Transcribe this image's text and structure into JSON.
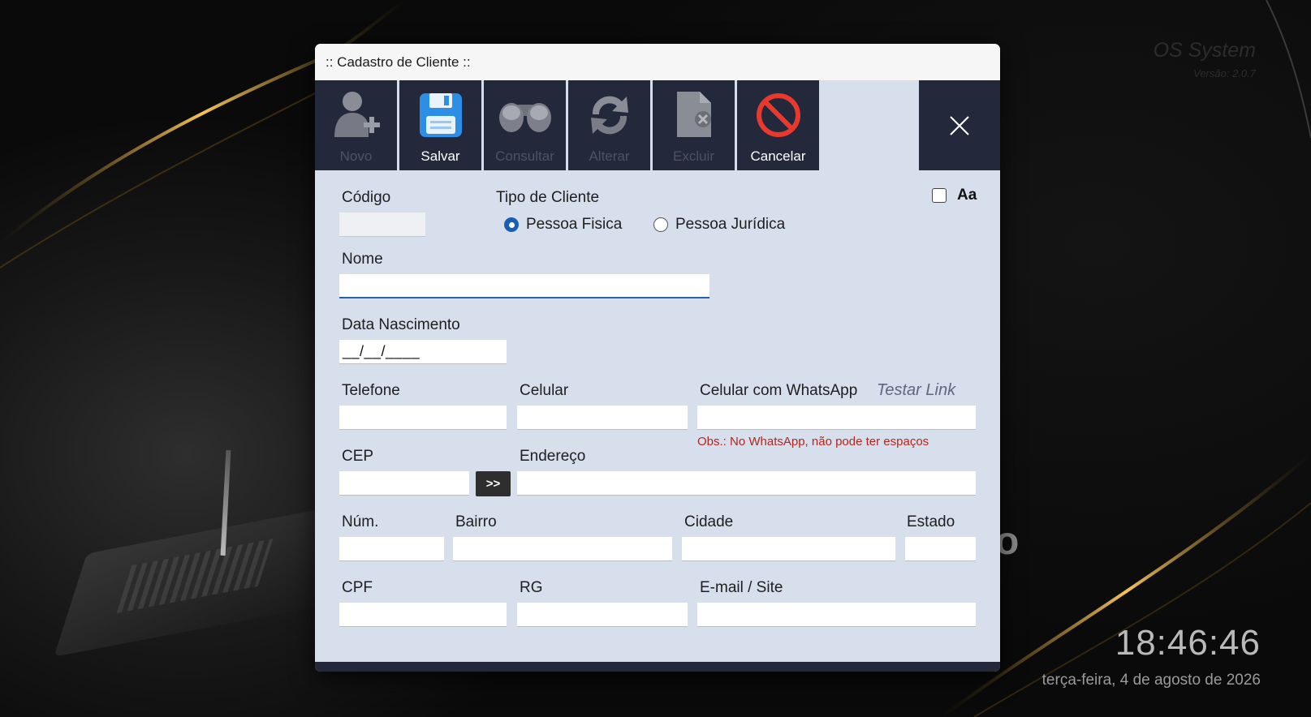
{
  "desktop": {
    "brand_title": "OS System",
    "brand_version": "Versão: 2.0.7",
    "clock": "18:46:46",
    "date": "terça-feira, 4 de agosto de 2026",
    "partial_letter": "o"
  },
  "window": {
    "title": ":: Cadastro de Cliente ::"
  },
  "toolbar": {
    "buttons": [
      {
        "label": "Novo",
        "icon": "add-user-icon",
        "enabled": false
      },
      {
        "label": "Salvar",
        "icon": "save-icon",
        "enabled": true
      },
      {
        "label": "Consultar",
        "icon": "binoculars-icon",
        "enabled": false
      },
      {
        "label": "Alterar",
        "icon": "refresh-icon",
        "enabled": false
      },
      {
        "label": "Excluir",
        "icon": "delete-file-icon",
        "enabled": false
      },
      {
        "label": "Cancelar",
        "icon": "cancel-icon",
        "enabled": true
      }
    ],
    "close_icon": "close-icon"
  },
  "form": {
    "codigo_label": "Código",
    "codigo_value": "",
    "tipo_cliente_label": "Tipo de Cliente",
    "pessoa_fisica_label": "Pessoa Fisica",
    "pessoa_juridica_label": "Pessoa Jurídica",
    "tipo_selected": "Pessoa Fisica",
    "aa_label": "Aa",
    "aa_checked": false,
    "nome_label": "Nome",
    "nome_value": "",
    "data_nascimento_label": "Data Nascimento",
    "data_nascimento_mask": "__/__/____",
    "telefone_label": "Telefone",
    "celular_label": "Celular",
    "celular_whatsapp_label": "Celular com WhatsApp",
    "testar_link_label": "Testar Link",
    "obs_text": "Obs.: No WhatsApp, não pode ter espaços",
    "cep_label": "CEP",
    "cep_button_label": ">>",
    "endereco_label": "Endereço",
    "num_label": "Núm.",
    "bairro_label": "Bairro",
    "cidade_label": "Cidade",
    "estado_label": "Estado",
    "cpf_label": "CPF",
    "rg_label": "RG",
    "email_label": "E-mail / Site"
  },
  "colors": {
    "toolbar_bg": "#23283a",
    "form_bg": "#d8dfec",
    "radio_accent": "#1a5fb4",
    "obs_red": "#b3261e",
    "link_gray": "#5c6780"
  }
}
